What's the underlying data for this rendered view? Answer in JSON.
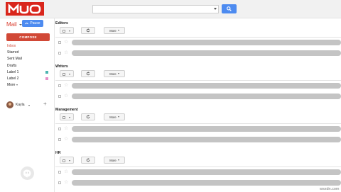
{
  "header": {
    "logo_text": "MUO",
    "search": {
      "value": "",
      "placeholder": ""
    }
  },
  "sidebar": {
    "app_label": "Mail",
    "pause_label": "Pause",
    "compose_label": "COMPOSE",
    "items": [
      {
        "label": "Inbox",
        "active": true
      },
      {
        "label": "Starred"
      },
      {
        "label": "Sent Mail"
      },
      {
        "label": "Drafts"
      },
      {
        "label": "Label 1",
        "color": "#4cb5b1"
      },
      {
        "label": "Label 2",
        "color": "#e78ec9"
      },
      {
        "label": "More"
      }
    ],
    "account": {
      "name": "Kayla",
      "add_symbol": "+"
    }
  },
  "toolbar": {
    "more_label": "More"
  },
  "sections": [
    {
      "title": "Editors"
    },
    {
      "title": "Writers"
    },
    {
      "title": "Management"
    },
    {
      "title": "HR"
    }
  ],
  "colors": {
    "brand_red": "#d9261c",
    "compose_red": "#d14836",
    "search_blue": "#4d8bf0",
    "redacted_bar": "#c4c4c4"
  },
  "watermark": "wsxdn.com"
}
